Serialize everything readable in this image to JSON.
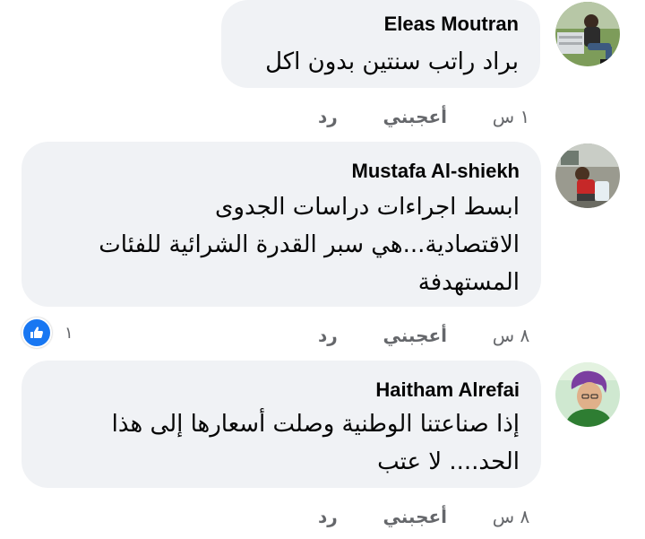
{
  "comments": [
    {
      "author": "Eleas Moutran",
      "text": "براد راتب سنتين بدون اكل",
      "time": "١ س",
      "like_label": "أعجبني",
      "reply_label": "رد"
    },
    {
      "author": "Mustafa Al-shiekh",
      "text": "ابسط اجراءات دراسات الجدوى\nالاقتصادية...هي سبر القدرة الشرائية للفئات\nالمستهدفة",
      "time": "٨ س",
      "like_label": "أعجبني",
      "reply_label": "رد",
      "reaction_count": "١"
    },
    {
      "author": "Haitham Alrefai",
      "text": "إذا صناعتنا الوطنية وصلت أسعارها إلى هذا\nالحد.... لا عتب",
      "time": "٨ س",
      "like_label": "أعجبني",
      "reply_label": "رد"
    }
  ],
  "colors": {
    "bubble": "#f0f2f5",
    "meta_text": "#65676b",
    "like_blue": "#1877f2"
  },
  "icons": {
    "like_reaction": "thumbs-up-icon"
  }
}
